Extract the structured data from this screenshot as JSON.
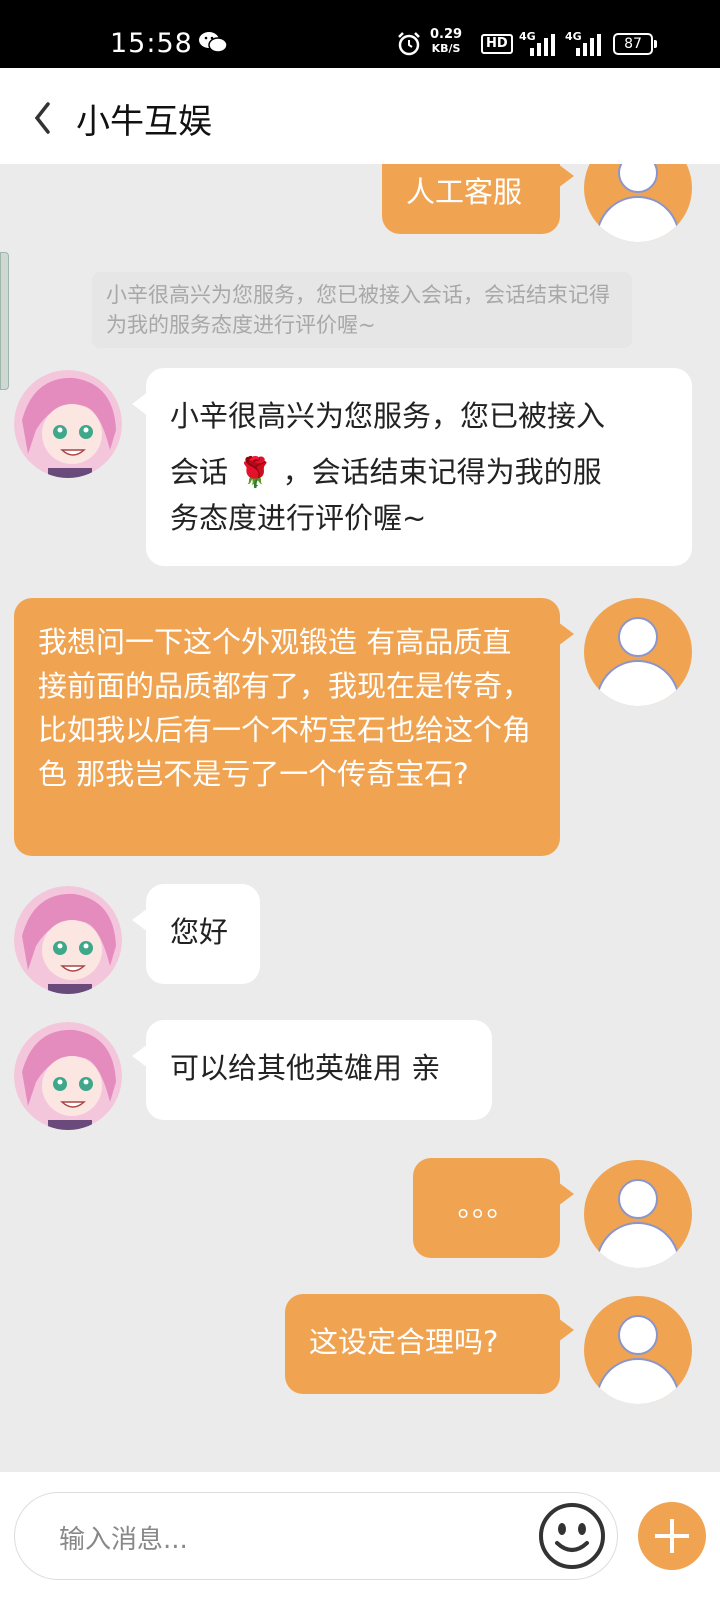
{
  "status_bar": {
    "time": "15:58",
    "net_speed_value": "0.29",
    "net_speed_unit": "KB/S",
    "hd_label": "HD",
    "network_1": "4G",
    "network_2": "4G",
    "battery": "87"
  },
  "header": {
    "title": "小牛互娱",
    "back_icon": "chevron-left-icon"
  },
  "chat": {
    "messages": [
      {
        "sender": "user",
        "text": "人工客服"
      },
      {
        "sender": "system",
        "text": "小辛很高兴为您服务，您已被接入会话，会话结束记得为我的服务态度进行评价喔~"
      },
      {
        "sender": "agent",
        "text_line1": "小辛很高兴为您服务，您已被接入",
        "text_line2a": "会话",
        "emoji": "🌹",
        "text_line2b": "，会话结束记得为我的服",
        "text_line3": "务态度进行评价喔~"
      },
      {
        "sender": "user",
        "text": "我想问一下这个外观锻造 有高品质直接前面的品质都有了，我现在是传奇， 比如我以后有一个不朽宝石也给这个角色 那我岂不是亏了一个传奇宝石?"
      },
      {
        "sender": "agent",
        "text": "您好"
      },
      {
        "sender": "agent",
        "text": "可以给其他英雄用 亲"
      },
      {
        "sender": "user",
        "text": "。。。"
      },
      {
        "sender": "user",
        "text": "这设定合理吗?"
      }
    ]
  },
  "input_bar": {
    "placeholder": "输入消息...",
    "emoji_icon": "smiley-icon",
    "plus_icon": "plus-icon"
  },
  "colors": {
    "accent": "#f0a452",
    "background": "#ebebeb",
    "agent_bubble": "#ffffff"
  }
}
